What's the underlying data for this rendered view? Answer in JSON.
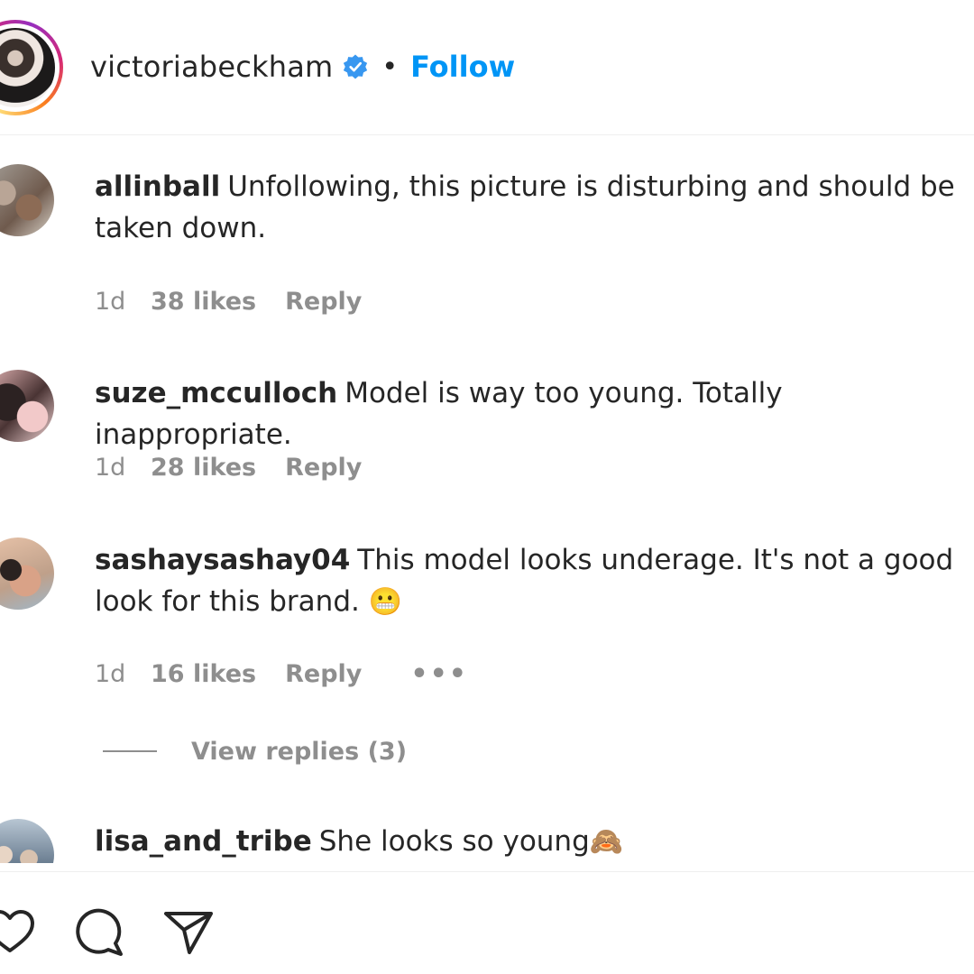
{
  "header": {
    "username": "victoriabeckham",
    "separator": "•",
    "follow_label": "Follow",
    "verified": true,
    "accent_color": "#0095f6"
  },
  "comments": [
    {
      "username": "allinball",
      "text": "Unfollowing, this picture is disturbing and should be taken down.",
      "time": "1d",
      "likes": "38 likes",
      "reply_label": "Reply"
    },
    {
      "username": "suze_mcculloch",
      "text": "Model is way too young. Totally inappropriate.",
      "time": "1d",
      "likes": "28 likes",
      "reply_label": "Reply"
    },
    {
      "username": "sashaysashay04",
      "text": "This model looks underage. It's not a good look for this brand.",
      "emoji": "😬",
      "time": "1d",
      "likes": "16 likes",
      "reply_label": "Reply",
      "more_label": "•••",
      "view_replies_label": "View replies (3)"
    },
    {
      "username": "lisa_and_tribe",
      "text": "She looks so young",
      "emoji": "🙈"
    }
  ],
  "actions": {
    "icons": [
      "heart-icon",
      "comment-icon",
      "share-icon"
    ]
  }
}
